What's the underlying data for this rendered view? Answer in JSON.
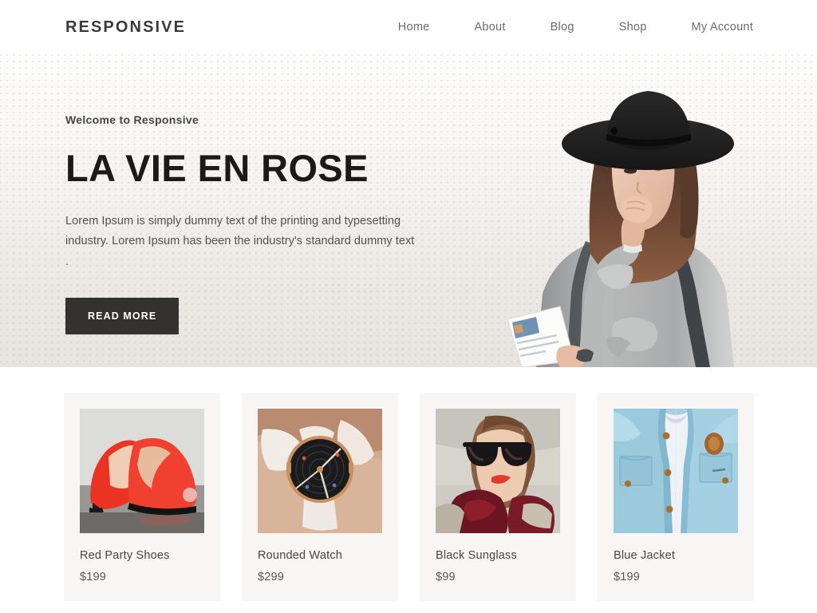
{
  "header": {
    "logo": "RESPONSIVE",
    "nav": [
      {
        "label": "Home"
      },
      {
        "label": "About"
      },
      {
        "label": "Blog"
      },
      {
        "label": "Shop"
      },
      {
        "label": "My Account"
      }
    ]
  },
  "hero": {
    "eyebrow": "Welcome to Responsive",
    "title": "LA VIE EN ROSE",
    "description": "Lorem Ipsum is simply dummy text of the printing and typesetting industry. Lorem Ipsum has been the industry's standard dummy text .",
    "cta_label": "READ MORE",
    "image_alt": "woman-with-black-hat-holding-papers"
  },
  "products": [
    {
      "name": "Red Party Shoes",
      "price": "$199",
      "image_alt": "red-high-heel-shoes"
    },
    {
      "name": "Rounded Watch",
      "price": "$299",
      "image_alt": "round-watch-on-wrist"
    },
    {
      "name": "Black Sunglass",
      "price": "$99",
      "image_alt": "woman-wearing-black-sunglasses"
    },
    {
      "name": "Blue Jacket",
      "price": "$199",
      "image_alt": "light-blue-denim-jacket"
    }
  ],
  "colors": {
    "accent_dark": "#333230",
    "text_dark": "#1c1a18",
    "text_muted": "#6f6a66",
    "card_bg": "#f7f6f4",
    "hero_bg": "#e7e3df"
  }
}
